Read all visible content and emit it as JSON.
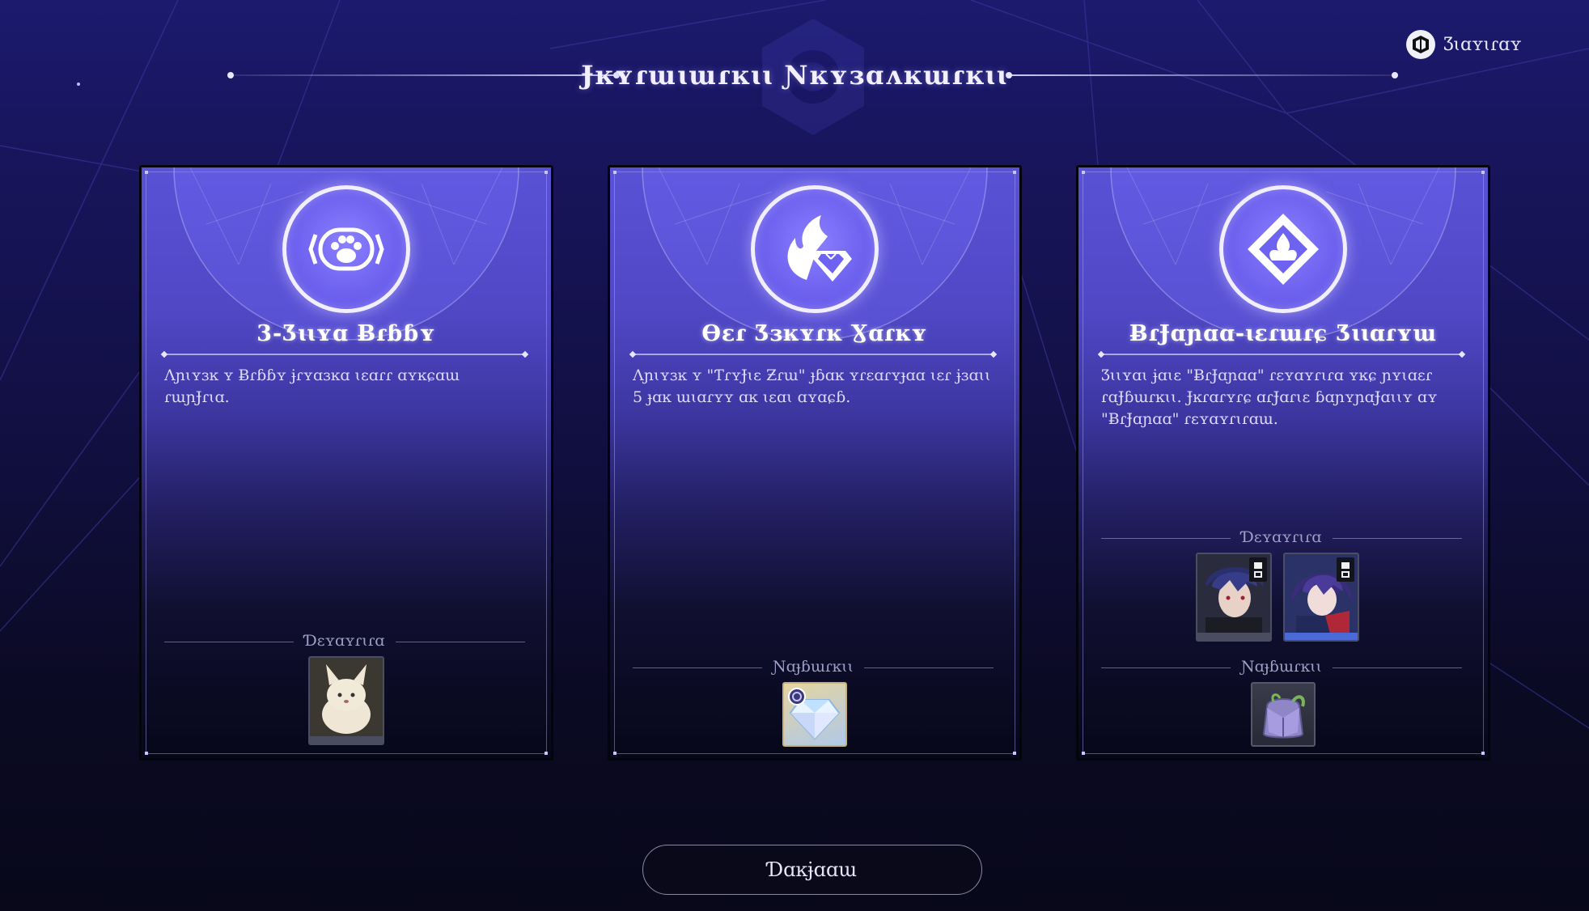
{
  "header": {
    "title": "Ɉĸʏɾɯɩɯɾĸɩɩ Ɲĸʏɜɑʌĸɯɾĸɩɩ",
    "menu_label": "Ʒɩɑʏɩɾɑʏ",
    "menu_icon": "menu-cube-icon"
  },
  "cards": [
    {
      "icon": "paw-icon",
      "title": "3-Ʒɩɩʏɑ Ƀɾɓɓʏ",
      "description": "Ʌɲɩʏɜĸ ʏ Ƀɾɓɓʏ ɉɾʏɑɜĸɑ ɩɛɑɾɾ ɑʏĸɕɑɯ ɾɯɲɈɾɩɑ.",
      "section_label": "Ɗɛʏɑʏɾɩɾɑ",
      "items": [
        {
          "name": "Fox companion",
          "icon": "fox-pet-icon"
        }
      ]
    },
    {
      "icon": "flame-diamond-icon",
      "title": "Ɵɛɾ Ʒɜĸʏɾĸ Ɣɑɾĸʏ",
      "description": "Ʌɲɩʏɜĸ ʏ \"ƬɾʏɈɩɛ Ƶɾɯ\" ɟɓɑĸ ʏɾɛɑɾʏɟɑɑ ɩɛɾ ɉɜɑɩɩ 5 ɟɑĸ ɯɩɑɾʏʏ ɑĸ ɩɛɑɩ ɑʏɑɕɓ.",
      "section_label": "Ɲɑɟɓɯɾĸɩɩ",
      "items": [
        {
          "name": "Crystal gem",
          "icon": "gem-icon"
        }
      ]
    },
    {
      "icon": "diamond-flame-icon",
      "title": "ɃɾɈɑɲɑɑ-ɩɛɾɯɾɕ Ʒɩɩɑɾʏɯ",
      "description": "Ʒɩɩʏɑɩ ɉɑɩɛ \"ɃɾɈɑɲɑɑ\" ɾɛʏɑʏɾɩɾɑ ʏĸɕ ɲʏɩɑɛɾ ɾɑɈɓɯɾĸɩɩ. Ɉĸɾɑɾʏɾɕ ɑɾɈɑɾɩɛ ɓɑɲʏɲɑɈɑɩɩʏ ɑʏ \"ɃɾɈɑɲɑɑ\" ɾɛʏɑʏɾɩɾɑɯ.",
      "character_section_label": "Ɗɛʏɑʏɾɩɾɑ",
      "characters": [
        {
          "name": "Character A",
          "icon": "character-portrait-icon"
        },
        {
          "name": "Character B",
          "icon": "character-portrait-icon"
        }
      ],
      "section_label": "Ɲɑɟɓɯɾĸɩɩ",
      "items": [
        {
          "name": "Backpack",
          "icon": "backpack-icon"
        }
      ]
    }
  ],
  "footer": {
    "continue_label": "Ɗɑĸɉɑɑɯ"
  },
  "colors": {
    "background": "#141252",
    "card_top": "#5a52d6",
    "accent": "#6e62f0",
    "text": "#ffffff"
  }
}
